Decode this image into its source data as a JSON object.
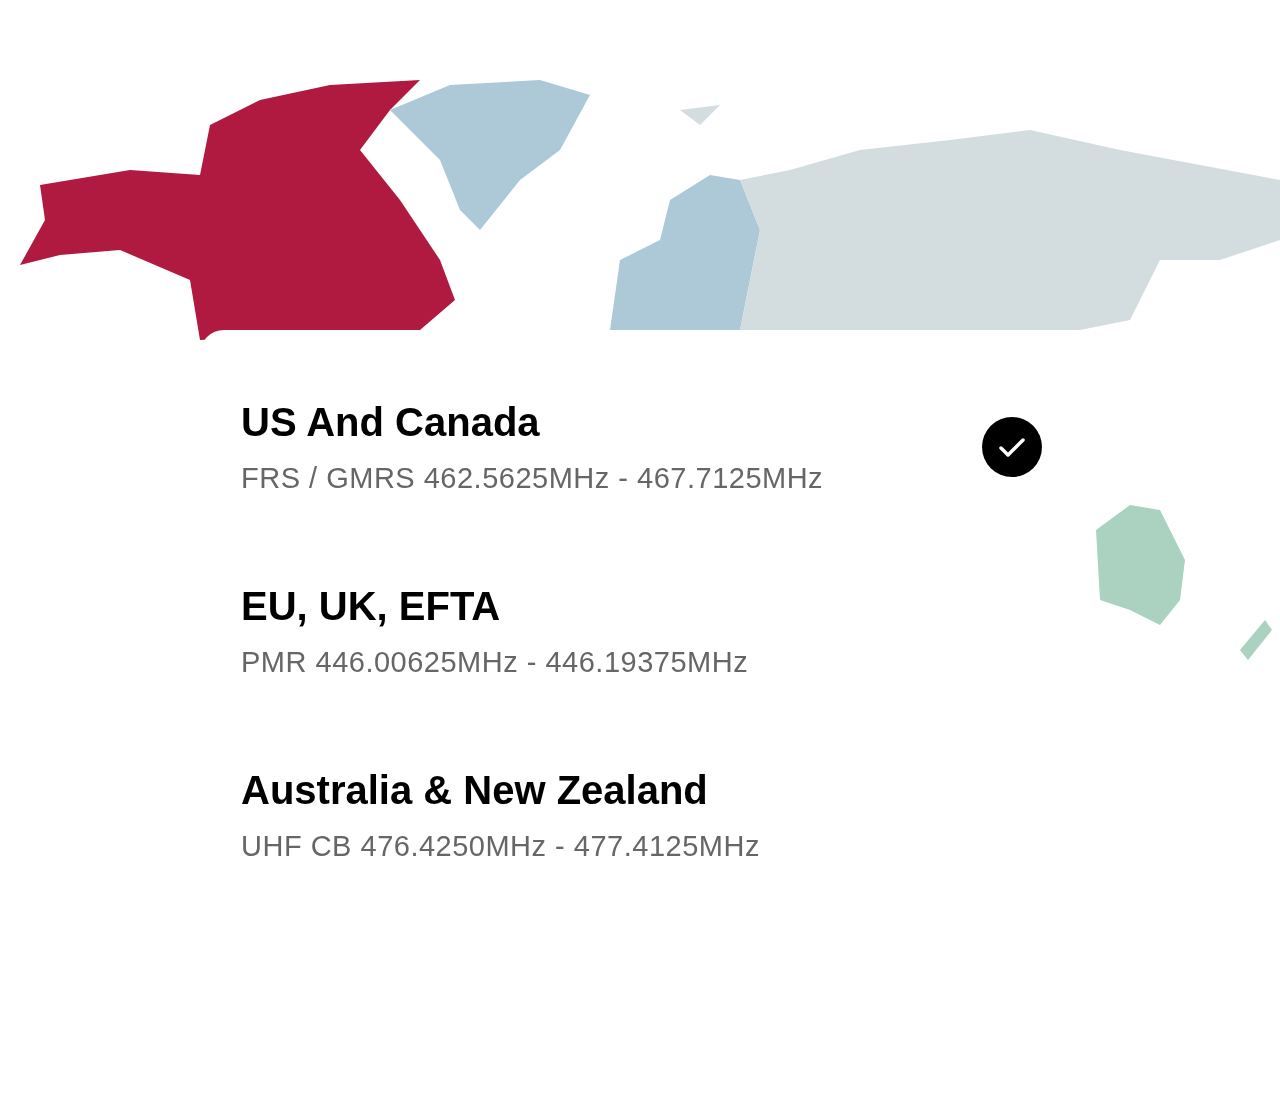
{
  "regions": [
    {
      "name": "US And Canada",
      "band": "FRS / GMRS 462.5625MHz - 467.7125MHz",
      "selected": true
    },
    {
      "name": "EU, UK, EFTA",
      "band": "PMR 446.00625MHz - 446.19375MHz",
      "selected": false
    },
    {
      "name": "Australia & New Zealand",
      "band": "UHF CB 476.4250MHz - 477.4125MHz",
      "selected": false
    }
  ]
}
